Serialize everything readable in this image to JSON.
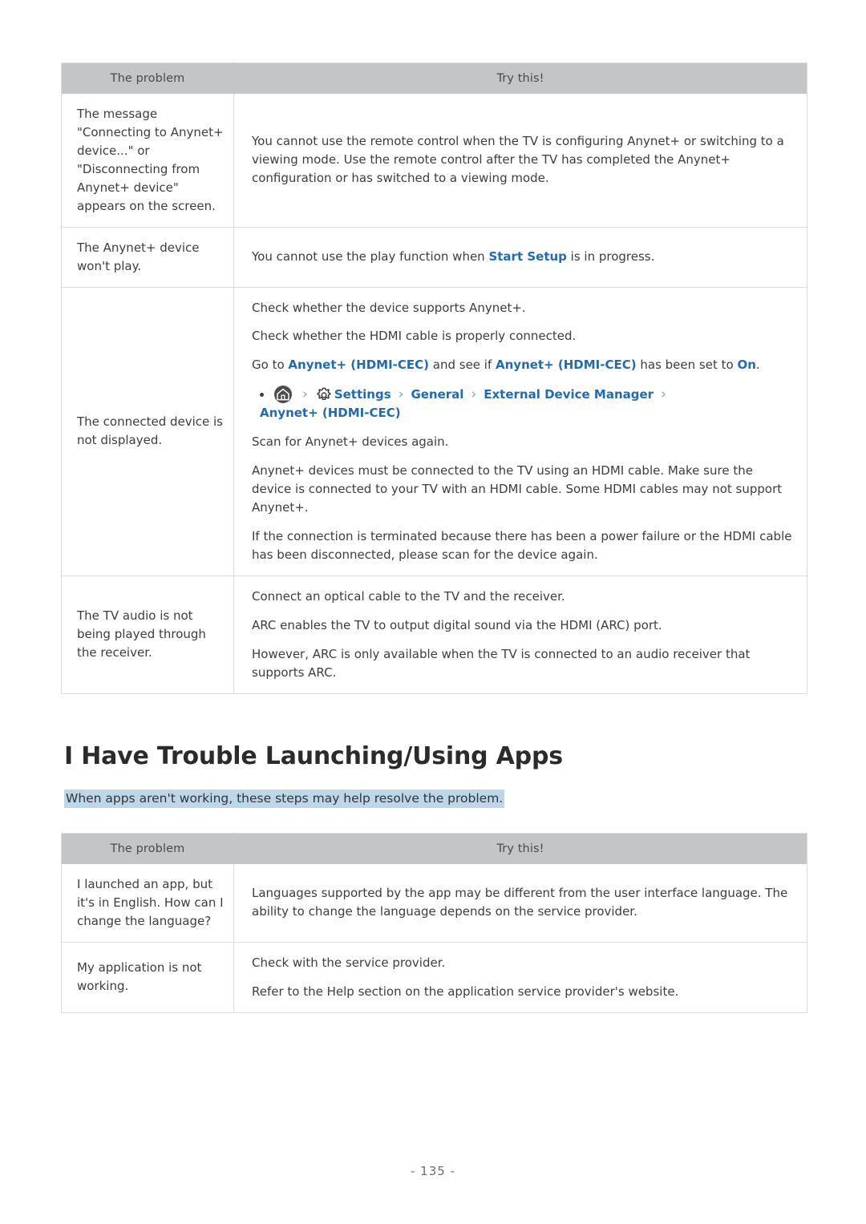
{
  "page": {
    "number_label": "- 135 -"
  },
  "table_one": {
    "headers": {
      "problem": "The problem",
      "try": "Try this!"
    },
    "rows": [
      {
        "problem": "The message \"Connecting to Anynet+ device...\" or \"Disconnecting from Anynet+ device\" appears on the screen.",
        "paragraphs": [
          "You cannot use the remote control when the TV is configuring Anynet+ or switching to a viewing mode. Use the remote control after the TV has completed the Anynet+ configuration or has switched to a viewing mode."
        ]
      },
      {
        "problem": "The Anynet+ device won't play.",
        "paragraphs": [
          "You cannot use the play function when Start Setup is in progress."
        ],
        "inline_link": "Start Setup",
        "sentence_before_link": "You cannot use the play function when ",
        "sentence_after_link": " is in progress."
      },
      {
        "problem": "The connected device is not displayed.",
        "paragraphs": [
          "Check whether the device supports Anynet+.",
          "Check whether the HDMI cable is properly connected."
        ],
        "goto_line": {
          "prefix": "Go to ",
          "link_one": "Anynet+ (HDMI-CEC)",
          "middle": " and see if ",
          "link_two": "Anynet+ (HDMI-CEC)",
          "middle_two": " has been set to ",
          "link_three": "On",
          "suffix": "."
        },
        "breadcrumb": {
          "home_icon": "home-icon",
          "gear_icon": "gear-icon",
          "separator": "›",
          "items": [
            "Settings",
            "General",
            "External Device Manager",
            "Anynet+ (HDMI-CEC)"
          ]
        },
        "paragraphs_after": [
          "Scan for Anynet+ devices again.",
          "Anynet+ devices must be connected to the TV using an HDMI cable. Make sure the device is connected to your TV with an HDMI cable. Some HDMI cables may not support Anynet+.",
          "If the connection is terminated because there has been a power failure or the HDMI cable has been disconnected, please scan for the device again."
        ]
      },
      {
        "problem": "The TV audio is not being played through the receiver.",
        "paragraphs": [
          "Connect an optical cable to the TV and the receiver.",
          "ARC enables the TV to output digital sound via the HDMI (ARC) port.",
          "However, ARC is only available when the TV is connected to an audio receiver that supports ARC."
        ]
      }
    ]
  },
  "section": {
    "title": "I Have Trouble Launching/Using Apps",
    "subtitle": "When apps aren't working, these steps may help resolve the problem."
  },
  "table_two": {
    "headers": {
      "problem": "The problem",
      "try": "Try this!"
    },
    "rows": [
      {
        "problem": "I launched an app, but it's in English. How can I change the language?",
        "paragraphs": [
          "Languages supported by the app may be different from the user interface language. The ability to change the language depends on the service provider."
        ]
      },
      {
        "problem": "My application is not working.",
        "paragraphs": [
          "Check with the service provider.",
          "Refer to the Help section on the application service provider's website."
        ]
      }
    ]
  },
  "colors": {
    "link": "#1f6bb5",
    "header_bg": "#c3c5c6",
    "highlight": "#bcd6ea",
    "border": "#dcdcdc"
  }
}
